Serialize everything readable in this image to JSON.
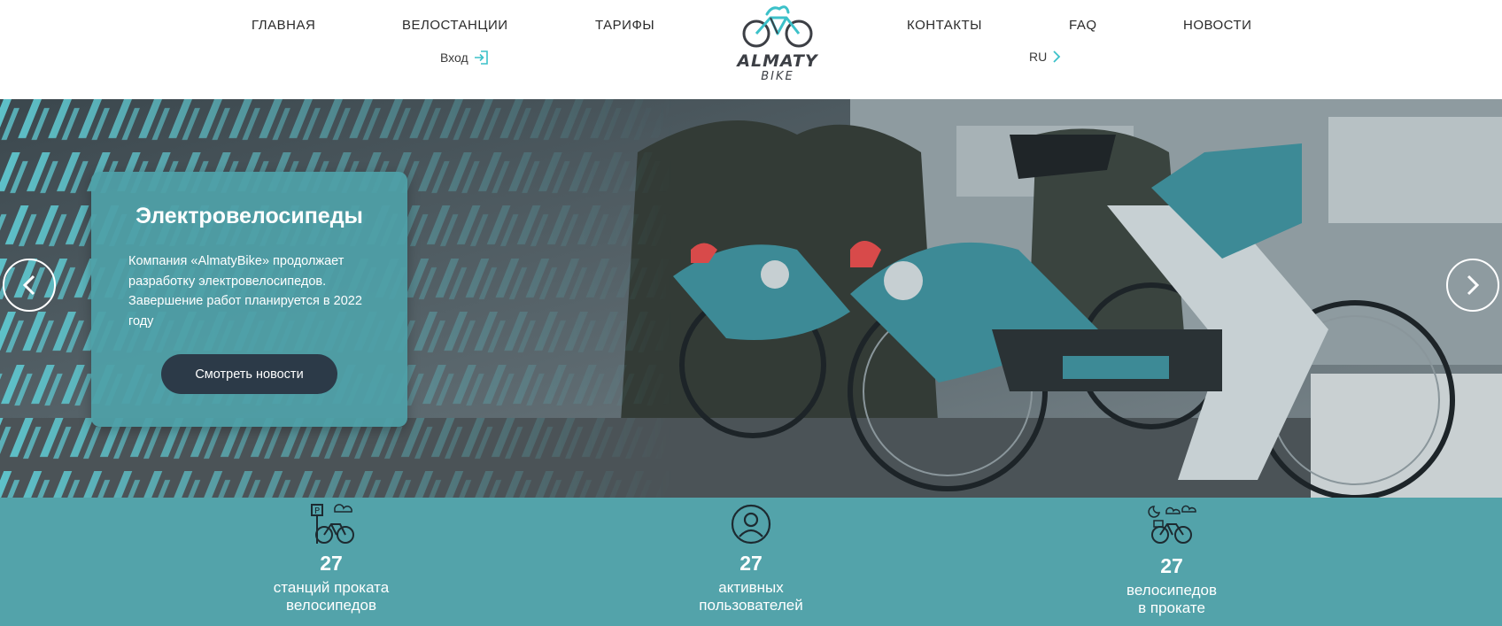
{
  "nav": {
    "left": [
      "ГЛАВНАЯ",
      "ВЕЛОСТАНЦИИ",
      "ТАРИФЫ"
    ],
    "right": [
      "КОНТАКТЫ",
      "FAQ",
      "НОВОСТИ"
    ],
    "login": "Вход",
    "language": "RU"
  },
  "logo": {
    "name": "ALMATY",
    "sub": "BIKE"
  },
  "hero": {
    "title": "Электровелосипеды",
    "text": "Компания «AlmatyBike» продолжает разработку электровелосипедов. Завершение работ планируется в 2022 году",
    "button": "Смотреть новости",
    "arrows": [
      "chevron-left-icon",
      "chevron-right-icon"
    ]
  },
  "stats": [
    {
      "icon": "parking-bike-icon",
      "value": "27",
      "line1": "станций проката",
      "line2": "велосипедов"
    },
    {
      "icon": "user-icon",
      "value": "27",
      "line1": "активных",
      "line2": "пользователей"
    },
    {
      "icon": "bike-rental-icon",
      "value": "27",
      "line1": "велосипедов",
      "line2": "в прокате"
    }
  ],
  "colors": {
    "accent": "#53a3aa",
    "button": "#2c3a48",
    "brand": "#3cc1c9"
  }
}
